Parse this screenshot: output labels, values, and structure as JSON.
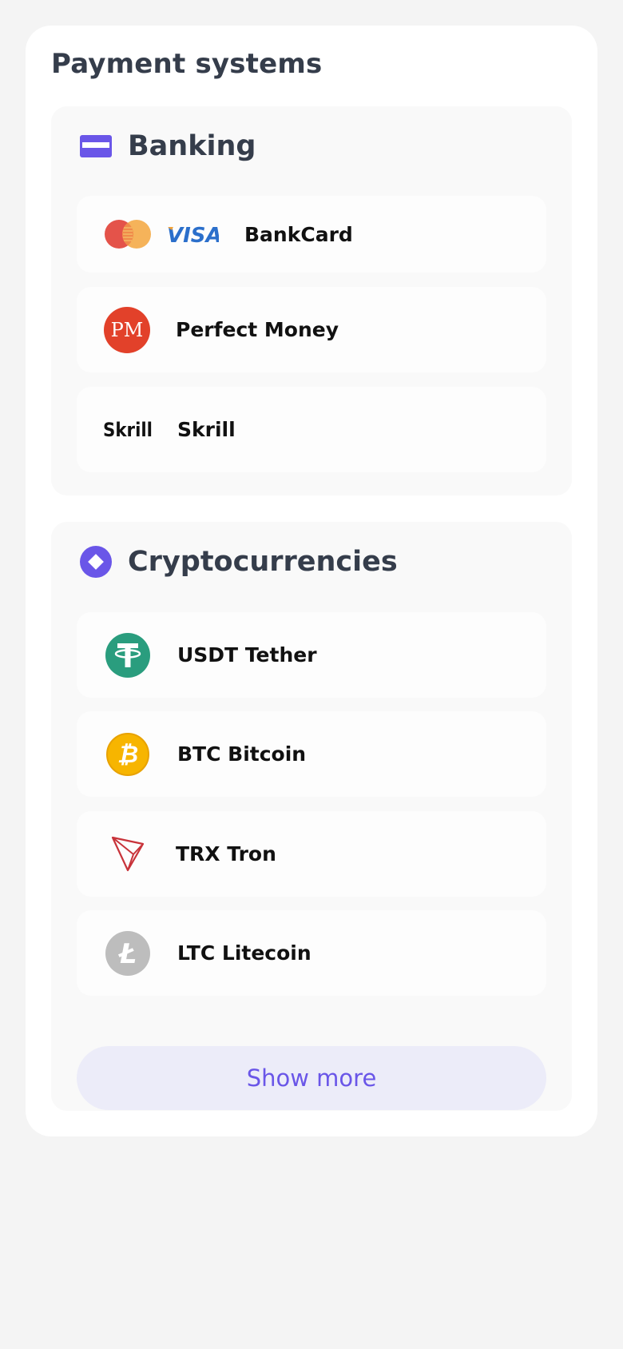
{
  "page": {
    "title": "Payment systems"
  },
  "colors": {
    "accent": "#6a56e8",
    "button_bg": "#ececf9",
    "section_title": "#353d4b"
  },
  "sections": {
    "banking": {
      "title": "Banking",
      "icon": "card-icon",
      "items": [
        {
          "label": "BankCard",
          "icons": [
            "mastercard-icon",
            "visa-icon"
          ],
          "visa_text": "VISA"
        },
        {
          "label": "Perfect Money",
          "icon": "perfect-money-icon",
          "icon_text": "PM"
        },
        {
          "label": "Skrill",
          "icon": "skrill-icon",
          "icon_text": "Skrill"
        }
      ]
    },
    "crypto": {
      "title": "Cryptocurrencies",
      "icon": "diamond-icon",
      "items": [
        {
          "label": "USDT Tether",
          "icon": "tether-icon",
          "icon_text": "T"
        },
        {
          "label": "BTC Bitcoin",
          "icon": "bitcoin-icon",
          "icon_text": "₿"
        },
        {
          "label": "TRX Tron",
          "icon": "tron-icon"
        },
        {
          "label": "LTC Litecoin",
          "icon": "litecoin-icon",
          "icon_text": "Ł"
        }
      ],
      "show_more_label": "Show more"
    }
  }
}
